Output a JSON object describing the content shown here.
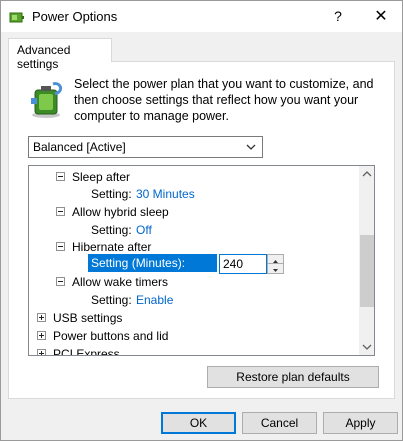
{
  "window": {
    "title": "Power Options",
    "help_glyph": "?",
    "close_glyph": "✕",
    "icon": "power-options-icon"
  },
  "tab": {
    "label": "Advanced settings"
  },
  "description": {
    "icon": "battery-power-icon",
    "text": "Select the power plan that you want to customize, and then choose settings that reflect how you want your computer to manage power."
  },
  "plan_select": {
    "value": "Balanced [Active]"
  },
  "tree": {
    "sleep_after": {
      "label": "Sleep after",
      "setting_key": "Setting:",
      "setting_value": "30 Minutes"
    },
    "hybrid_sleep": {
      "label": "Allow hybrid sleep",
      "setting_key": "Setting:",
      "setting_value": "Off"
    },
    "hibernate_after": {
      "label": "Hibernate after",
      "setting_key": "Setting (Minutes):",
      "setting_value": "240"
    },
    "wake_timers": {
      "label": "Allow wake timers",
      "setting_key": "Setting:",
      "setting_value": "Enable"
    },
    "usb": {
      "label": "USB settings"
    },
    "power_buttons": {
      "label": "Power buttons and lid"
    },
    "pci_express": {
      "label": "PCI Express"
    }
  },
  "buttons": {
    "restore": "Restore plan defaults",
    "ok": "OK",
    "cancel": "Cancel",
    "apply": "Apply"
  },
  "colors": {
    "accent": "#0078d7",
    "value_link": "#0066cc"
  }
}
